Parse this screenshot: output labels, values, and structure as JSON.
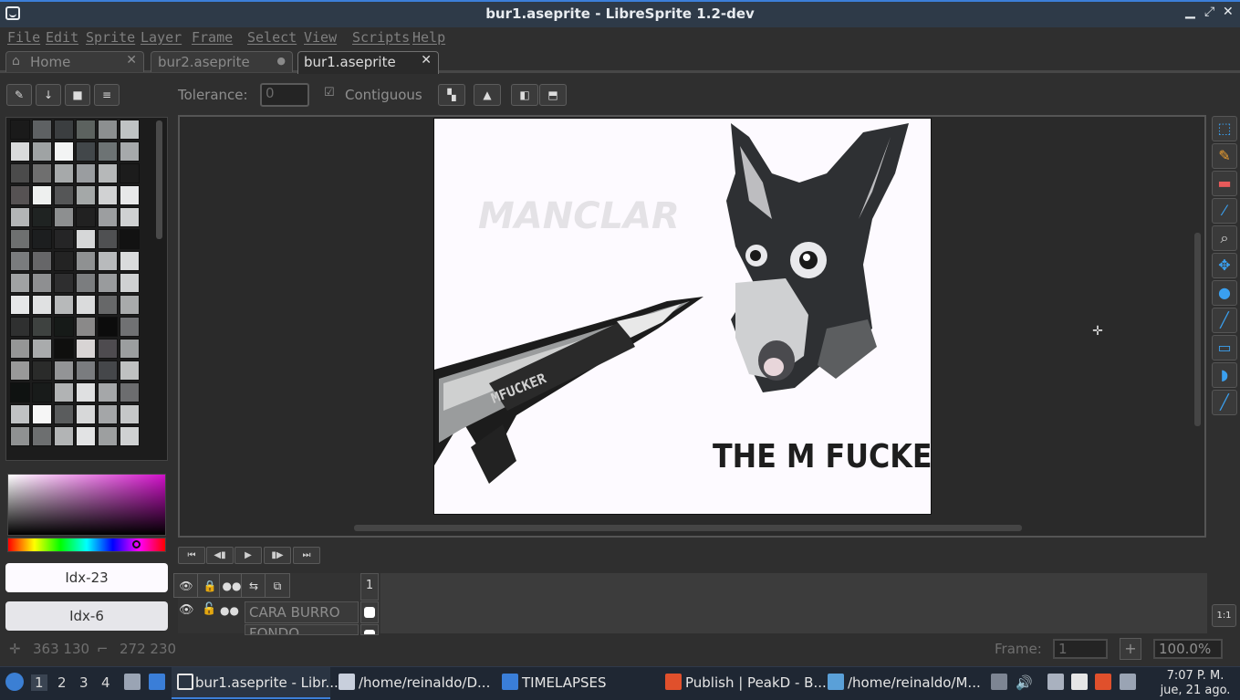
{
  "window": {
    "title": "bur1.aseprite - LibreSprite 1.2-dev"
  },
  "menu": [
    "File",
    "Edit",
    "Sprite",
    "Layer",
    "Frame",
    "Select",
    "View",
    "Scripts",
    "Help"
  ],
  "tabs": [
    {
      "label": "Home",
      "close": "✕"
    },
    {
      "label": "bur2.aseprite",
      "close": "●"
    },
    {
      "label": "bur1.aseprite",
      "close": "✕"
    }
  ],
  "toolbar": {
    "tolerance_label": "Tolerance:",
    "tolerance_value": "0",
    "contiguous_label": "Contiguous",
    "contiguous_checked": true
  },
  "palette": {
    "colors": [
      "#1a1a1a",
      "#5e6163",
      "#3b3e40",
      "#5c625f",
      "#8c8f90",
      "#bfc3c4",
      "#d9dadb",
      "#9fa3a4",
      "#f3f4f4",
      "#42474a",
      "#6d7374",
      "#a6a9ab",
      "#4b4b4b",
      "#6f6f6f",
      "#a6a9aa",
      "#9a9da0",
      "#b6b8b9",
      "#1c1c1c",
      "#565253",
      "#eef0ef",
      "#555657",
      "#a4a8a8",
      "#d1d2d3",
      "#e7e8e9",
      "#b3b5b6",
      "#1f2322",
      "#8d8f90",
      "#212121",
      "#9c9ea0",
      "#cfd1d2",
      "#6e7070",
      "#1c1e1f",
      "#252526",
      "#d6d7d8",
      "#4f5052",
      "#121212",
      "#7a7c7e",
      "#666668",
      "#232323",
      "#8f9192",
      "#b8babc",
      "#dadbdc",
      "#a0a2a3",
      "#8e8f91",
      "#2e2e2f",
      "#7b7d7f",
      "#999b9d",
      "#cfd1d2",
      "#e6e7e8",
      "#e0e1e2",
      "#b7b9ba",
      "#dadbdc",
      "#676869",
      "#a8aaab",
      "#2f3030",
      "#3e4240",
      "#161a18",
      "#8a8989",
      "#0c0c0c",
      "#707173",
      "#959696",
      "#a9abac",
      "#0f0f0e",
      "#d8d4d4",
      "#4e4b4f",
      "#9b9e9f",
      "#999999",
      "#2a2b2a",
      "#939496",
      "#7a7c7f",
      "#45474a",
      "#bfc1c1",
      "#0f1211",
      "#181b1a",
      "#b1b3b4",
      "#dfe0e1",
      "#a5a7a9",
      "#6c6d6f",
      "#c0c2c4",
      "#f6f6f6",
      "#5a5c5d",
      "#d7d8d9",
      "#a4a6a8",
      "#c5c7c8",
      "#8f9192",
      "#6d6f70",
      "#b2b4b5",
      "#e2e3e4",
      "#9d9fa0",
      "#cfd1d2"
    ],
    "fg_index": "Idx-23",
    "bg_index": "Idx-6"
  },
  "sprite_text": {
    "logo": "MANCLAR",
    "rocket": "MFUCKER",
    "caption": "THE M FUCKER"
  },
  "timeline": {
    "frame_header": "1",
    "layers": [
      {
        "name": "CARA BURRO"
      },
      {
        "name": "FONDO"
      }
    ]
  },
  "status": {
    "pos": "363 130",
    "size": "272 230",
    "frame_label": "Frame:",
    "frame_value": "1",
    "zoom": "100.0%"
  },
  "taskbar": {
    "workspaces": [
      "1",
      "2",
      "3",
      "4"
    ],
    "tasks": [
      "bur1.aseprite - Libr...",
      "/home/reinaldo/D...",
      "TIMELAPSES",
      "Publish | PeakD - B...",
      "/home/reinaldo/M..."
    ],
    "clock_time": "7:07 P. M.",
    "clock_date": "jue, 21 ago."
  },
  "colors": {
    "accent": "#3aa0f0",
    "brand": "#2e3a48"
  }
}
